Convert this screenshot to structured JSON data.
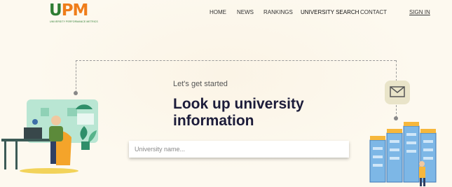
{
  "brand": {
    "logo_main_1": "U",
    "logo_main_2": "PM",
    "logo_sub": "UNIVERSITY PERFORMANCE METRICS"
  },
  "nav": {
    "home": "HOME",
    "news": "NEWS",
    "rankings": "RANKINGS",
    "university_search": "UNIVERSITY SEARCH",
    "contact": "CONTACT",
    "sign_in": "SIGN IN"
  },
  "hero": {
    "eyebrow": "Let's get started",
    "headline": "Look up university information"
  },
  "search": {
    "placeholder": "University name...",
    "value": ""
  },
  "colors": {
    "logo_green": "#2e7d32",
    "logo_orange": "#ef7d1a",
    "headline": "#1c1c3a",
    "background": "#fdf9ef"
  },
  "icons": [
    "mail-icon"
  ]
}
